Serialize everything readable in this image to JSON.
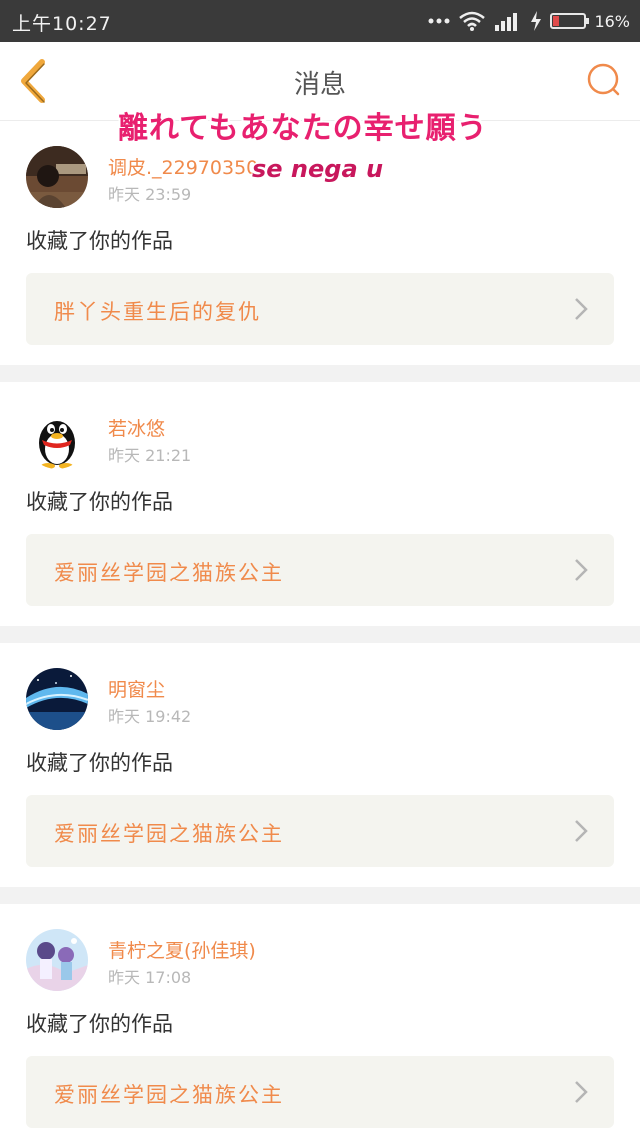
{
  "status_bar": {
    "time": "上午10:27",
    "battery_text": "16%",
    "battery_level": 0.16,
    "icons": [
      "more-dots-icon",
      "wifi-icon",
      "signal-icon",
      "charging-icon",
      "battery-icon"
    ]
  },
  "header": {
    "title": "消息",
    "back_icon": "chevron-left-icon",
    "search_icon": "search-icon"
  },
  "overlay": {
    "line1": "離れてもあなたの幸せ願う",
    "line2": "se nega u"
  },
  "messages": [
    {
      "user": "调皮._22970350",
      "time": "昨天 23:59",
      "text": "收藏了你的作品",
      "work": "胖丫头重生后的复仇"
    },
    {
      "user": "若冰悠",
      "time": "昨天 21:21",
      "text": "收藏了你的作品",
      "work": "爱丽丝学园之猫族公主"
    },
    {
      "user": "明窗尘",
      "time": "昨天 19:42",
      "text": "收藏了你的作品",
      "work": "爱丽丝学园之猫族公主"
    },
    {
      "user": "青柠之夏(孙佳琪)",
      "time": "昨天 17:08",
      "text": "收藏了你的作品",
      "work": "爱丽丝学园之猫族公主"
    }
  ],
  "colors": {
    "accent": "#f08a4b",
    "status_bar_bg": "#3a3a3a",
    "card_bg": "#f4f4ef",
    "overlay_text": "#e8206f"
  }
}
